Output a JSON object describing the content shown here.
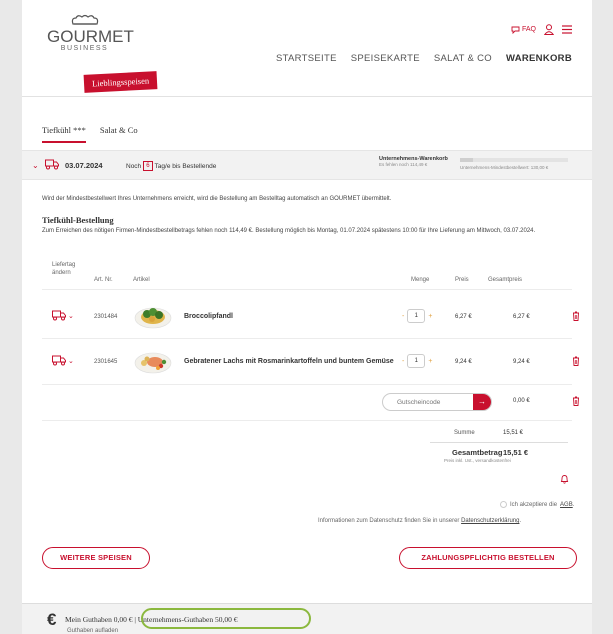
{
  "header": {
    "logo_word": "GOURMET",
    "logo_sub": "BUSINESS",
    "banner": "Lieblingsspeisen",
    "faq": "FAQ",
    "nav": [
      "STARTSEITE",
      "SPEISEKARTE",
      "SALAT & CO",
      "WARENKORB"
    ]
  },
  "tabs": [
    "Tiefkühl ***",
    "Salat & Co"
  ],
  "delivery": {
    "date": "03.07.2024",
    "noch": "Noch",
    "days": "6",
    "suffix": "Tag/e bis Bestellende",
    "uw_title": "Unternehmens-Warenkorb",
    "uw_sub": "Es fehlen noch 114,49 €",
    "mindest": "Unternehmens-Mindestbestellwert: 130,00 €",
    "progress": 0.12
  },
  "info_text": "Wird der Mindestbestellwert Ihres Unternehmens erreicht, wird die Bestellung am Bestelltag automatisch an GOURMET übermittelt.",
  "section": {
    "title": "Tiefkühl-Bestellung",
    "text": "Zum Erreichen des nötigen Firmen-Mindestbestellbetrags fehlen noch 114,49 €. Bestellung möglich bis Montag, 01.07.2024 spätestens 10:00 für Ihre Lieferung am Mittwoch, 03.07.2024."
  },
  "table": {
    "headers": {
      "liefertag": "Liefertag",
      "aendern": "ändern",
      "artnr": "Art. Nr.",
      "artikel": "Artikel",
      "menge": "Menge",
      "preis": "Preis",
      "gesamtpreis": "Gesamtpreis"
    },
    "rows": [
      {
        "artnr": "2301484",
        "name": "Broccolipfandl",
        "qty": "1",
        "price": "6,27 €",
        "total": "6,27 €"
      },
      {
        "artnr": "2301645",
        "name": "Gebratener Lachs mit Rosmarinkartoffeln und buntem Gemüse",
        "qty": "1",
        "price": "9,24 €",
        "total": "9,24 €"
      }
    ]
  },
  "voucher": {
    "placeholder": "Gutscheincode",
    "value": "0,00 €"
  },
  "totals": {
    "summe_label": "Summe",
    "summe_value": "15,51 €",
    "gesamt_label": "Gesamtbetrag",
    "gesamt_value": "15,51 €",
    "note": "Preis inkl. Ust., versandkostenfrei"
  },
  "agb": {
    "prefix": "Ich akzeptiere die",
    "link": "AGB",
    "suffix": "."
  },
  "privacy": {
    "prefix": "Informationen zum Datenschutz finden Sie in unserer",
    "link": "Datenschutzerklärung",
    "suffix": "."
  },
  "buttons": {
    "weitere": "WEITERE SPEISEN",
    "bestellen": "ZAHLUNGSPFLICHTIG BESTELLEN"
  },
  "footer": {
    "euro": "€",
    "mein": "Mein Guthaben 0,00 € | Unternehmens-Guthaben 50,00 €",
    "aufladen": "Guthaben aufladen"
  },
  "colors": {
    "accent": "#c8102e",
    "highlight": "#8bb83e"
  }
}
